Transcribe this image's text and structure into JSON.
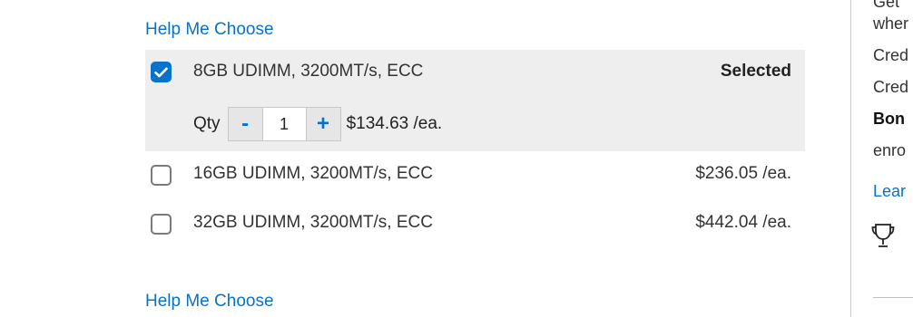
{
  "help_link_top": "Help Me Choose",
  "help_link_bottom": "Help Me Choose",
  "options": [
    {
      "label": "8GB UDIMM, 3200MT/s, ECC",
      "checked": true,
      "selected_label": "Selected",
      "qty_label": "Qty",
      "qty_minus": "-",
      "qty_value": "1",
      "qty_plus": "+",
      "price": "$134.63 /ea."
    },
    {
      "label": "16GB UDIMM, 3200MT/s, ECC",
      "checked": false,
      "price": "$236.05 /ea."
    },
    {
      "label": "32GB UDIMM, 3200MT/s, ECC",
      "checked": false,
      "price": "$442.04 /ea."
    }
  ],
  "side_panel": {
    "lines": [
      "Get",
      "wher",
      "Cred",
      "Cred",
      "Bon",
      "enro"
    ],
    "link": "Lear",
    "icon": "trophy-icon"
  },
  "colors": {
    "accent": "#0672cb",
    "selected_bg": "#eeeeee"
  }
}
